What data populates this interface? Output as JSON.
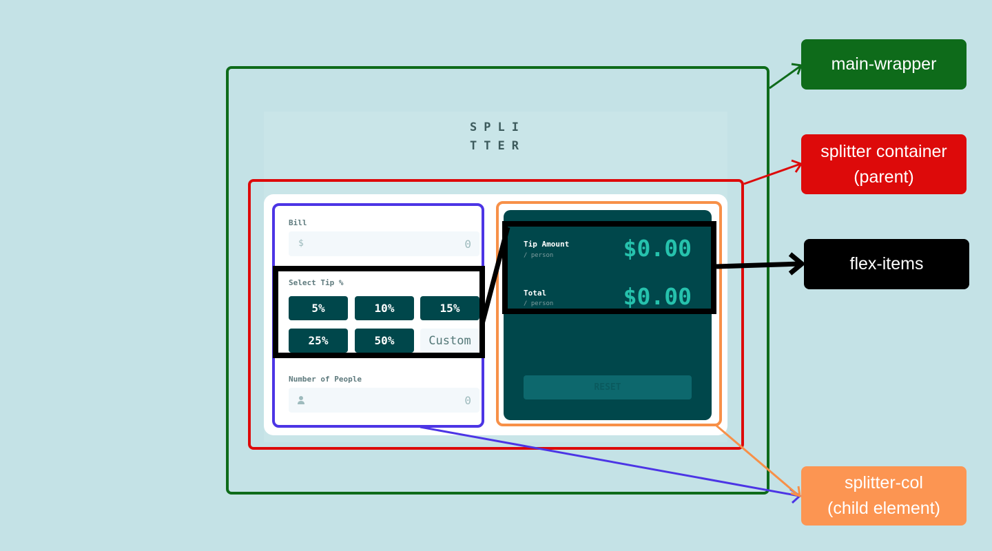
{
  "app": {
    "logo_line1": "SPLI",
    "logo_line2": "TTER",
    "bill": {
      "label": "Bill",
      "value": "0",
      "icon": "dollar-icon"
    },
    "tip": {
      "label": "Select Tip %",
      "options": [
        "5%",
        "10%",
        "15%",
        "25%",
        "50%"
      ],
      "custom_placeholder": "Custom"
    },
    "people": {
      "label": "Number of People",
      "value": "0",
      "icon": "person-icon"
    },
    "results": {
      "tip_amount": {
        "label": "Tip Amount",
        "sub": "/ person",
        "value": "$0.00"
      },
      "total": {
        "label": "Total",
        "sub": "/ person",
        "value": "$0.00"
      },
      "reset_label": "RESET"
    }
  },
  "annotations": {
    "main_wrapper": {
      "text": "main-wrapper",
      "color": "#0e6b1a"
    },
    "splitter_container": {
      "line1": "splitter container",
      "line2": "(parent)",
      "color": "#dd0a0a"
    },
    "flex_items": {
      "text": "flex-items",
      "color": "#000000"
    },
    "splitter_col": {
      "line1": "splitter-col",
      "line2": "(child element)",
      "color": "#fc9552"
    }
  },
  "colors": {
    "background": "#c4e2e6",
    "dark_cyan": "#00474b",
    "strong_cyan": "#26c2ad",
    "blue_outline": "#4c35e5"
  }
}
